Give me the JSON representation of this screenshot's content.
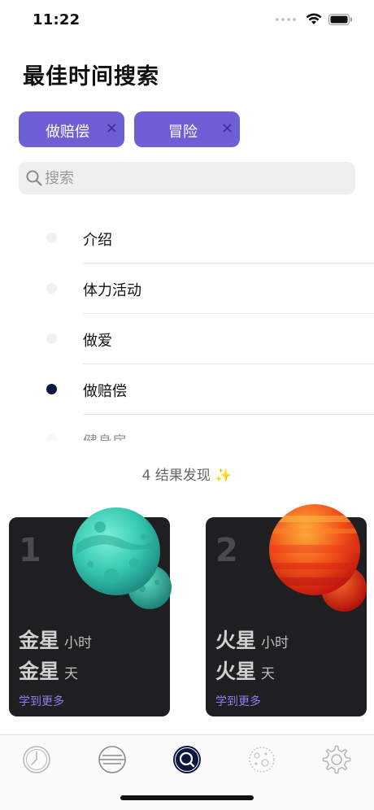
{
  "status_bar": {
    "time": "11:22"
  },
  "page": {
    "title": "最佳时间搜索"
  },
  "filters": [
    {
      "label": "做赔偿",
      "close": "✕"
    },
    {
      "label": "冒险",
      "close": "✕"
    }
  ],
  "search": {
    "placeholder": "搜索"
  },
  "activities": [
    {
      "label": "介绍",
      "selected": false
    },
    {
      "label": "体力活动",
      "selected": false
    },
    {
      "label": "做爱",
      "selected": false
    },
    {
      "label": "做赔偿",
      "selected": true
    },
    {
      "label": "健身房",
      "selected": false
    }
  ],
  "results": {
    "text": "4 结果发现 ✨"
  },
  "cards": [
    {
      "rank": "1",
      "value_1": "金星",
      "unit_1": "小时",
      "value_2": "金星",
      "unit_2": "天",
      "link": "学到更多",
      "planet_color": "#3fd1b8"
    },
    {
      "rank": "2",
      "value_1": "火星",
      "unit_1": "小时",
      "value_2": "火星",
      "unit_2": "天",
      "link": "学到更多",
      "planet_color": "#f2541b"
    }
  ],
  "tab_bar": {
    "tabs": [
      {
        "icon": "clock-icon",
        "active": false
      },
      {
        "icon": "planet-rings-icon",
        "active": false
      },
      {
        "icon": "search-icon",
        "active": true
      },
      {
        "icon": "moon-icon",
        "active": false
      },
      {
        "icon": "gear-icon",
        "active": false
      }
    ],
    "active_color": "#0e1740",
    "inactive_color": "#b8b8b8"
  }
}
